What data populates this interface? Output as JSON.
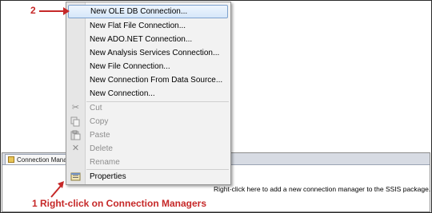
{
  "panel": {
    "tab_label": "Connection Mana",
    "hint": "Right-click here to add a new connection manager to the SSIS package."
  },
  "context_menu": {
    "items": [
      {
        "label": "New OLE DB Connection...",
        "enabled": true,
        "highlighted": true
      },
      {
        "label": "New Flat File Connection...",
        "enabled": true
      },
      {
        "label": "New ADO.NET Connection...",
        "enabled": true
      },
      {
        "label": "New Analysis Services Connection...",
        "enabled": true
      },
      {
        "label": "New File Connection...",
        "enabled": true
      },
      {
        "label": "New Connection From Data Source...",
        "enabled": true
      },
      {
        "label": "New Connection...",
        "enabled": true
      },
      {
        "label": "Cut",
        "enabled": false,
        "icon": "cut-icon"
      },
      {
        "label": "Copy",
        "enabled": false,
        "icon": "copy-icon"
      },
      {
        "label": "Paste",
        "enabled": false,
        "icon": "paste-icon"
      },
      {
        "label": "Delete",
        "enabled": false,
        "icon": "delete-icon"
      },
      {
        "label": "Rename",
        "enabled": false
      },
      {
        "label": "Properties",
        "enabled": true,
        "icon": "properties-icon"
      }
    ]
  },
  "annotations": {
    "step2": "2",
    "step1": "1 Right-click on Connection Managers",
    "color": "#c62828"
  }
}
